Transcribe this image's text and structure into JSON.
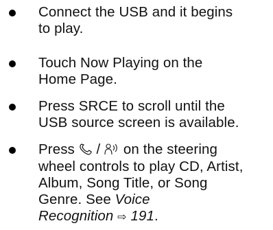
{
  "items": [
    {
      "line1": "Connect the USB and it begins",
      "line2": "to play."
    },
    {
      "line1": "Touch Now Playing on the",
      "line2": "Home Page."
    },
    {
      "line1": "Press SRCE to scroll until the",
      "line2": "USB source screen is available."
    },
    {
      "prefix": "Press",
      "icon_phone": "phone-handset-icon",
      "separator": "/",
      "icon_voice": "voice-recognition-icon",
      "line1_rest": "on the steering",
      "line2": "wheel controls to play CD, Artist,",
      "line3": "Album, Song Title, or Song",
      "line4_start": "Genre. See",
      "link_part1": "Voice",
      "link_part2": "Recognition",
      "page_ref": "191",
      "period": "."
    }
  ]
}
